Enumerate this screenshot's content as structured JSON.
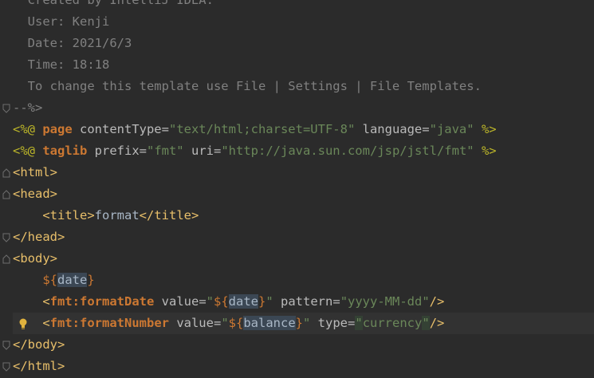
{
  "editor": {
    "comment_lines": [
      "  Created by IntelliJ IDEA.",
      "  User: Kenji",
      "  Date: 2021/6/3",
      "  Time: 18:18",
      "  To change this template use File | Settings | File Templates."
    ],
    "comment_end": "--%>",
    "directive1": {
      "open": "<%@ ",
      "keyword": "page",
      "attr1": " contentType=",
      "val1": "\"text/html;charset=UTF-8\"",
      "attr2": " language=",
      "val2": "\"java\"",
      "close": " %>"
    },
    "directive2": {
      "open": "<%@ ",
      "keyword": "taglib",
      "attr1": " prefix=",
      "val1": "\"fmt\"",
      "attr2": " uri=",
      "val2": "\"http://java.sun.com/jsp/jstl/fmt\"",
      "close": " %>"
    },
    "html_open": "<html>",
    "head_open": "<head>",
    "title_open": "<title>",
    "title_text": "format",
    "title_close": "</title>",
    "head_close": "</head>",
    "body_open": "<body>",
    "el_line": {
      "indent": "    ",
      "open": "${",
      "id": "date",
      "close": "}"
    },
    "format_date": {
      "indent": "    ",
      "lt": "<",
      "tag": "fmt:formatDate",
      "attr1": " value=",
      "q_open": "\"",
      "el_open": "${",
      "el_id": "date",
      "el_close": "}",
      "q_close": "\"",
      "attr2": " pattern=",
      "val2": "\"yyyy-MM-dd\"",
      "end": "/>"
    },
    "format_number": {
      "indent": "    ",
      "lt": "<",
      "tag": "fmt:formatNumber",
      "attr1": " value=",
      "q_open": "\"",
      "el_open": "${",
      "el_id": "balance",
      "el_close": "}",
      "q_close": "\"",
      "attr2": " type=",
      "q2_open": "\"",
      "val2": "currency",
      "q2_close": "\"",
      "end": "/>"
    },
    "body_close": "</body>",
    "html_close": "</html>",
    "indent": "    "
  }
}
